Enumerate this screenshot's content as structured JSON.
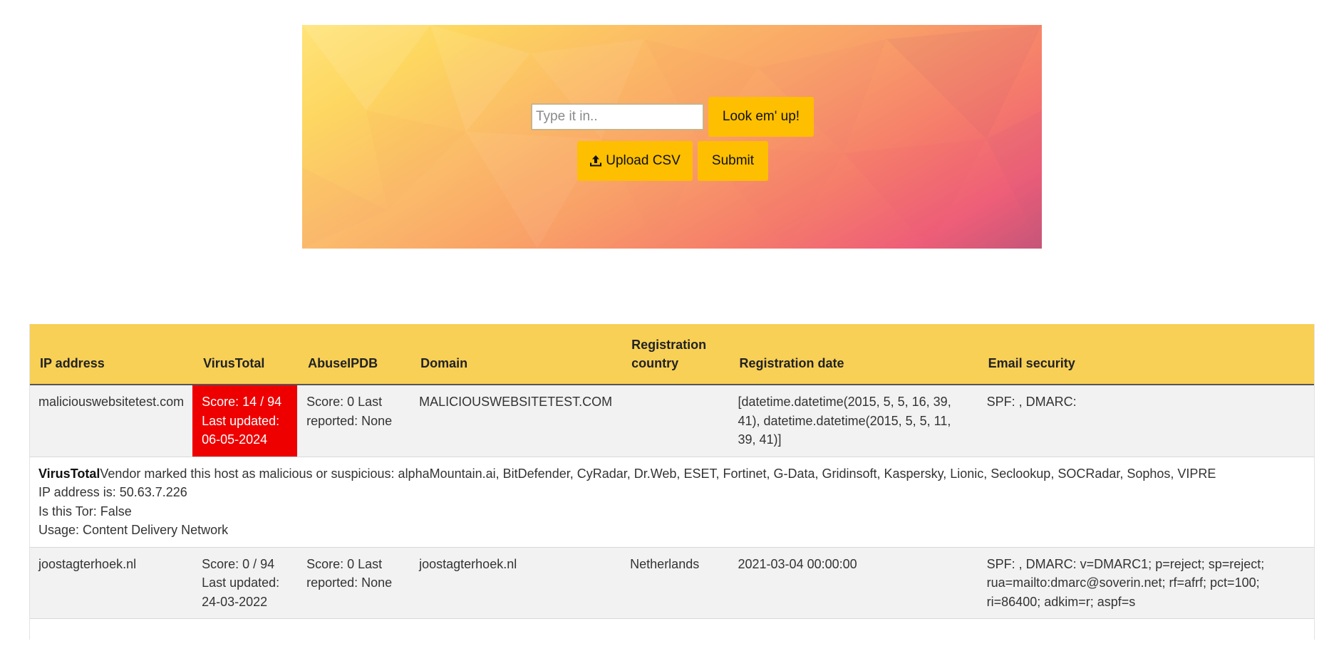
{
  "search": {
    "placeholder": "Type it in..",
    "value": "",
    "lookup_label": "Look em' up!"
  },
  "upload": {
    "upload_label": "Upload CSV",
    "upload_icon": "upload-icon",
    "submit_label": "Submit"
  },
  "colors": {
    "accent": "#fdbf00",
    "header_bg": "#f8d056",
    "malicious": "#ee0000"
  },
  "table": {
    "headers": {
      "ip": "IP address",
      "virustotal": "VirusTotal",
      "abuseipdb": "AbuseIPDB",
      "domain": "Domain",
      "reg_country": "Registration country",
      "reg_date": "Registration date",
      "email": "Email security"
    },
    "rows": [
      {
        "ip": "maliciouswebsitetest.com",
        "vt_score": "Score: 14 / 94",
        "vt_updated": "Last updated: 06-05-2024",
        "abuse": "Score: 0 Last reported: None",
        "domain": "MALICIOUSWEBSITETEST.COM",
        "country": "",
        "reg_date": "[datetime.datetime(2015, 5, 5, 16, 39, 41), datetime.datetime(2015, 5, 5, 11, 39, 41)]",
        "email": "SPF: , DMARC:",
        "detail": {
          "title": "VirusTotal",
          "vendors": "Vendor marked this host as malicious or suspicious: alphaMountain.ai, BitDefender, CyRadar, Dr.Web, ESET, Fortinet, G-Data, Gridinsoft, Kaspersky, Lionic, Seclookup, SOCRadar, Sophos, VIPRE",
          "ip": "IP address is: 50.63.7.226",
          "tor": "Is this Tor: False",
          "usage": "Usage: Content Delivery Network"
        }
      },
      {
        "ip": "joostagterhoek.nl",
        "vt_score": "Score: 0 / 94",
        "vt_updated": "Last updated: 24-03-2022",
        "abuse": "Score: 0 Last reported: None",
        "domain": "joostagterhoek.nl",
        "country": "Netherlands",
        "reg_date": "2021-03-04 00:00:00",
        "email": "SPF: , DMARC: v=DMARC1; p=reject; sp=reject; rua=mailto:dmarc@soverin.net; rf=afrf; pct=100; ri=86400; adkim=r; aspf=s"
      }
    ]
  }
}
